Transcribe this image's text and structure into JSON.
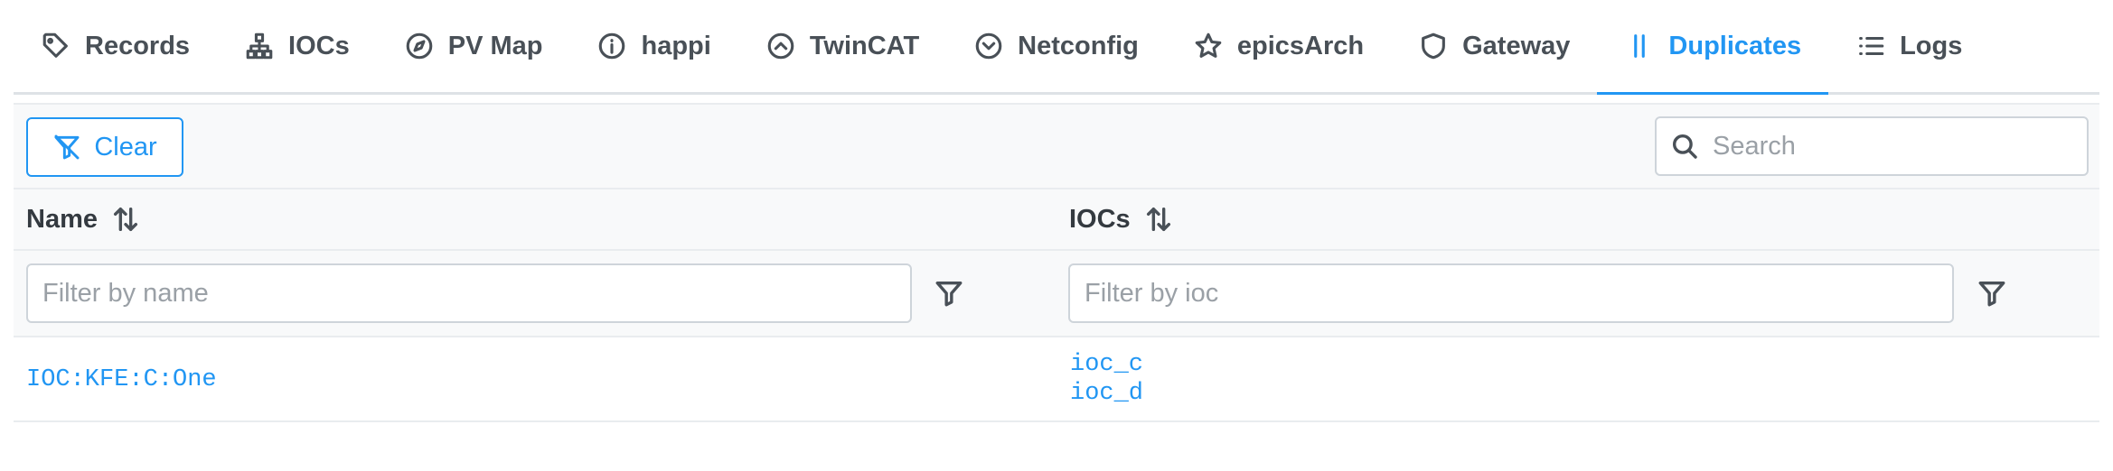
{
  "tabs": [
    {
      "label": "Records",
      "icon": "tag-icon",
      "active": false
    },
    {
      "label": "IOCs",
      "icon": "sitemap-icon",
      "active": false
    },
    {
      "label": "PV Map",
      "icon": "compass-icon",
      "active": false
    },
    {
      "label": "happi",
      "icon": "info-circle-icon",
      "active": false
    },
    {
      "label": "TwinCAT",
      "icon": "chevron-up-circle-icon",
      "active": false
    },
    {
      "label": "Netconfig",
      "icon": "chevron-down-circle-icon",
      "active": false
    },
    {
      "label": "epicsArch",
      "icon": "star-icon",
      "active": false
    },
    {
      "label": "Gateway",
      "icon": "shield-icon",
      "active": false
    },
    {
      "label": "Duplicates",
      "icon": "pause-icon",
      "active": true
    },
    {
      "label": "Logs",
      "icon": "list-icon",
      "active": false
    }
  ],
  "toolbar": {
    "clear_label": "Clear",
    "search_placeholder": "Search"
  },
  "table": {
    "columns": [
      {
        "label": "Name",
        "filter_placeholder": "Filter by name"
      },
      {
        "label": "IOCs",
        "filter_placeholder": "Filter by ioc"
      }
    ],
    "rows": [
      {
        "name": "IOC:KFE:C:One",
        "iocs": [
          "ioc_c",
          "ioc_d"
        ]
      }
    ]
  },
  "colors": {
    "accent": "#2196f3",
    "text": "#495057",
    "border": "#dee2e6",
    "header_bg": "#f8f9fa"
  }
}
